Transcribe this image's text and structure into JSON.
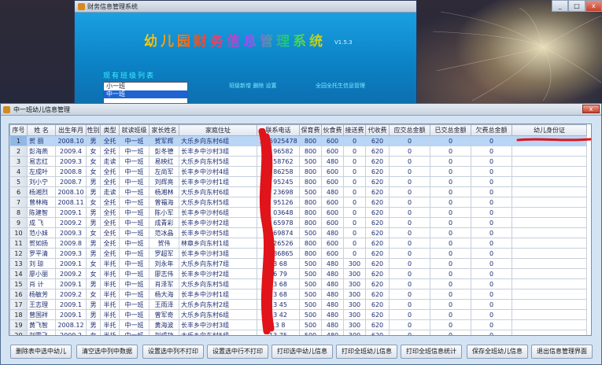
{
  "background_app": {
    "title": "财务信息管理系统",
    "banner": "幼儿园财务信息管理系统",
    "version": "V1.5.3",
    "class_list_title": "现有班级列表",
    "class_list": [
      "小一班",
      "中一班"
    ],
    "selected_class_index": 1,
    "link_1": "班级新增  删除 设置",
    "link_2": "全园全托生信息管理"
  },
  "window": {
    "title": "中一班幼儿信息管理",
    "close_label": "x"
  },
  "system_buttons": {
    "minimize": "_",
    "maximize": "□",
    "close": "x"
  },
  "table": {
    "columns": [
      "序号",
      "姓  名",
      "出生年月",
      "性别",
      "类型",
      "就读班级",
      "家长姓名",
      "家庭住址",
      "联系电话",
      "保育费",
      "伙食费",
      "接送费",
      "代收费",
      "应交总金额",
      "已交总金额",
      "欠费总金额",
      "幼儿身份证"
    ],
    "selected_row": 0,
    "rows": [
      [
        "1",
        "贺  丽",
        "2008.10",
        "男",
        "全托",
        "中一班",
        "贺军辉",
        "大乐乡向东村6组",
        "13 5925478",
        "800",
        "600",
        "0",
        "620",
        "0",
        "0",
        "0",
        ""
      ],
      [
        "2",
        "彭海燕",
        "2009.4",
        "女",
        "全托",
        "中一班",
        "彭冬德",
        "长丰乡中沙村3组",
        "15 96582",
        "800",
        "600",
        "0",
        "620",
        "0",
        "0",
        "0",
        ""
      ],
      [
        "3",
        "易志红",
        "2009.3",
        "女",
        "走读",
        "中一班",
        "易映红",
        "大乐乡向东村5组",
        "13 58762",
        "500",
        "480",
        "0",
        "620",
        "0",
        "0",
        "0",
        ""
      ],
      [
        "4",
        "左成叶",
        "2008.8",
        "女",
        "全托",
        "中一班",
        "左尚军",
        "长丰乡中沙村4组",
        "13 86258",
        "800",
        "600",
        "0",
        "620",
        "0",
        "0",
        "0",
        ""
      ],
      [
        "5",
        "刘小宁",
        "2008.7",
        "男",
        "全托",
        "中一班",
        "刘辉亮",
        "长丰乡中沙村1组",
        "13 95245",
        "800",
        "600",
        "0",
        "620",
        "0",
        "0",
        "0",
        ""
      ],
      [
        "6",
        "杨湘烈",
        "2008.10",
        "男",
        "走读",
        "中一班",
        "杨湘林",
        "大乐乡向东村6组",
        "15 23698",
        "500",
        "480",
        "0",
        "620",
        "0",
        "0",
        "0",
        ""
      ],
      [
        "7",
        "曾林梅",
        "2008.11",
        "女",
        "全托",
        "中一班",
        "曾福海",
        "大乐乡向东村5组",
        "13 95126",
        "800",
        "600",
        "0",
        "620",
        "0",
        "0",
        "0",
        ""
      ],
      [
        "8",
        "陈建智",
        "2009.1",
        "男",
        "全托",
        "中一班",
        "陈小军",
        "长丰乡中沙村6组",
        "13 03648",
        "800",
        "600",
        "0",
        "620",
        "0",
        "0",
        "0",
        ""
      ],
      [
        "9",
        "成  飞",
        "2009.2",
        "男",
        "全托",
        "中一班",
        "成青彩",
        "长丰乡中沙村2组",
        "13 65978",
        "800",
        "600",
        "0",
        "620",
        "0",
        "0",
        "0",
        ""
      ],
      [
        "10",
        "范小妹",
        "2009.3",
        "女",
        "全托",
        "中一班",
        "范冰晶",
        "长丰乡中沙村5组",
        "13 69874",
        "500",
        "480",
        "0",
        "620",
        "0",
        "0",
        "0",
        ""
      ],
      [
        "11",
        "贺如扬",
        "2009.8",
        "男",
        "全托",
        "中一班",
        "贺伟",
        "林章乡向东村1组",
        "13 26526",
        "800",
        "600",
        "0",
        "620",
        "0",
        "0",
        "0",
        ""
      ],
      [
        "12",
        "罗平清",
        "2009.3",
        "男",
        "全托",
        "中一班",
        "罗超军",
        "长丰乡中沙村3组",
        "13 86865",
        "800",
        "600",
        "0",
        "620",
        "0",
        "0",
        "0",
        ""
      ],
      [
        "13",
        "刘  琼",
        "2009.1",
        "女",
        "半托",
        "中一班",
        "刘永年",
        "大乐乡向东村7组",
        "13 68",
        "500",
        "480",
        "300",
        "620",
        "0",
        "0",
        "0",
        ""
      ],
      [
        "14",
        "廖小丽",
        "2009.2",
        "女",
        "半托",
        "中一班",
        "廖志伟",
        "长丰乡中沙村2组",
        "16 79",
        "500",
        "480",
        "300",
        "620",
        "0",
        "0",
        "0",
        ""
      ],
      [
        "15",
        "肖  计",
        "2009.1",
        "男",
        "半托",
        "中一班",
        "肖泽军",
        "大乐乡向东村5组",
        "13 68",
        "500",
        "480",
        "300",
        "620",
        "0",
        "0",
        "0",
        ""
      ],
      [
        "16",
        "杨敏芳",
        "2009.2",
        "女",
        "半托",
        "中一班",
        "杨大海",
        "长丰乡中沙村1组",
        "13 68",
        "500",
        "480",
        "300",
        "620",
        "0",
        "0",
        "0",
        ""
      ],
      [
        "17",
        "王志理",
        "2009.1",
        "男",
        "半托",
        "中一班",
        "王雨泽",
        "大乐乡向东村2组",
        "13 45",
        "500",
        "480",
        "300",
        "620",
        "0",
        "0",
        "0",
        ""
      ],
      [
        "18",
        "曾国祥",
        "2009.1",
        "男",
        "半托",
        "中一班",
        "曾军奇",
        "大乐乡向东村6组",
        "13 42",
        "500",
        "480",
        "300",
        "620",
        "0",
        "0",
        "0",
        ""
      ],
      [
        "19",
        "黄飞智",
        "2008.12",
        "男",
        "半托",
        "中一班",
        "黄海波",
        "长丰乡中沙村3组",
        "13 8",
        "500",
        "480",
        "300",
        "620",
        "0",
        "0",
        "0",
        ""
      ],
      [
        "20",
        "刘雪飞",
        "2009.2",
        "女",
        "半托",
        "中一班",
        "刘成功",
        "大乐乡向东村5组",
        "13 75",
        "500",
        "480",
        "300",
        "620",
        "0",
        "0",
        "0",
        ""
      ]
    ]
  },
  "buttons": [
    "删除表中选中幼儿",
    "清空选中列中数据",
    "设置选中列不打印",
    "设置选中行不打印",
    "打印选中幼儿信息",
    "打印全班幼儿信息",
    "打印全班信息统计",
    "保存全班幼儿信息",
    "退出信息管理界面"
  ],
  "scrollbar": {
    "up": "▲",
    "down": "▼"
  },
  "colors": {
    "redaction": "#e0141a",
    "selected_row": "#b9d6f6",
    "grid_text": "#1d2c70"
  }
}
